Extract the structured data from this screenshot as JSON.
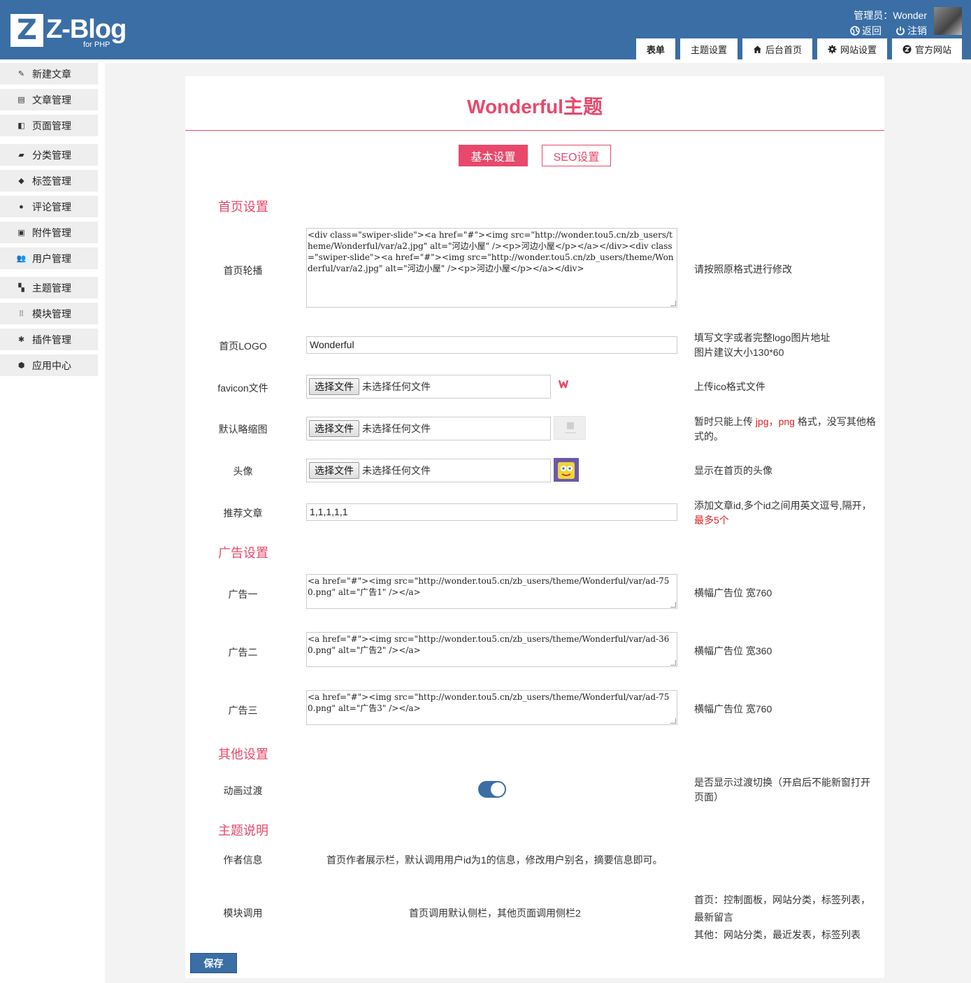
{
  "header": {
    "logo_letter": "Z",
    "logo_text": "Z-Blog",
    "logo_sub": "for PHP",
    "admin": "管理员：Wonder",
    "back": "返回",
    "logout": "注销",
    "tabs": [
      {
        "label": "表单",
        "icon": ""
      },
      {
        "label": "主题设置",
        "icon": ""
      },
      {
        "label": "后台首页",
        "icon": "home-icon"
      },
      {
        "label": "网站设置",
        "icon": "gear-icon"
      },
      {
        "label": "官方网站",
        "icon": "zblog-icon"
      }
    ]
  },
  "sidebar": {
    "items": [
      {
        "label": "新建文章",
        "icon": "edit-icon"
      },
      {
        "label": "文章管理",
        "icon": "article-icon"
      },
      {
        "label": "页面管理",
        "icon": "page-icon"
      },
      {
        "label": "分类管理",
        "icon": "folder-icon"
      },
      {
        "label": "标签管理",
        "icon": "tag-icon"
      },
      {
        "label": "评论管理",
        "icon": "comment-icon"
      },
      {
        "label": "附件管理",
        "icon": "attachment-icon"
      },
      {
        "label": "用户管理",
        "icon": "users-icon"
      },
      {
        "label": "主题管理",
        "icon": "theme-icon"
      },
      {
        "label": "模块管理",
        "icon": "module-icon"
      },
      {
        "label": "插件管理",
        "icon": "plugin-icon"
      },
      {
        "label": "应用中心",
        "icon": "app-center-icon"
      }
    ]
  },
  "page": {
    "title": "Wonderful主题",
    "tab_basic": "基本设置",
    "tab_seo": "SEO设置",
    "accent": "#e8486b",
    "brand": "#3a6ea5"
  },
  "sections": {
    "home": "首页设置",
    "ads": "广告设置",
    "other": "其他设置",
    "notes": "主题说明"
  },
  "fields": {
    "slider": {
      "label": "首页轮播",
      "value": "<div class=\"swiper-slide\"><a href=\"#\"><img src=\"http://wonder.tou5.cn/zb_users/theme/Wonderful/var/a2.jpg\" alt=\"河边小屋\" /><p>河边小屋</p></a></div><div class=\"swiper-slide\"><a href=\"#\"><img src=\"http://wonder.tou5.cn/zb_users/theme/Wonderful/var/a2.jpg\" alt=\"河边小屋\" /><p>河边小屋</p></a></div>",
      "hint": "请按照原格式进行修改"
    },
    "logo": {
      "label": "首页LOGO",
      "value": "Wonderful",
      "hint1": "填写文字或者完整logo图片地址",
      "hint2": "图片建议大小130*60"
    },
    "favicon": {
      "label": "favicon文件",
      "button": "选择文件",
      "status": "未选择任何文件",
      "hint": "上传ico格式文件"
    },
    "thumb": {
      "label": "默认略缩图",
      "button": "选择文件",
      "status": "未选择任何文件",
      "hint_a": "暂时只能上传 ",
      "hint_jpg": "jpg",
      "hint_comma": "，",
      "hint_png": "png",
      "hint_b": " 格式，没写其他格式的。"
    },
    "avatar": {
      "label": "头像",
      "button": "选择文件",
      "status": "未选择任何文件",
      "hint": "显示在首页的头像"
    },
    "recommend": {
      "label": "推荐文章",
      "value": "1,1,1,1,1",
      "hint": "添加文章id,多个id之间用英文逗号,隔开，",
      "hint_red": "最多5个"
    },
    "ad1": {
      "label": "广告一",
      "value": "<a href=\"#\"><img src=\"http://wonder.tou5.cn/zb_users/theme/Wonderful/var/ad-750.png\" alt=\"广告1\" /></a>",
      "hint": "横幅广告位 宽760"
    },
    "ad2": {
      "label": "广告二",
      "value": "<a href=\"#\"><img src=\"http://wonder.tou5.cn/zb_users/theme/Wonderful/var/ad-360.png\" alt=\"广告2\" /></a>",
      "hint": "横幅广告位 宽360"
    },
    "ad3": {
      "label": "广告三",
      "value": "<a href=\"#\"><img src=\"http://wonder.tou5.cn/zb_users/theme/Wonderful/var/ad-750.png\" alt=\"广告3\" /></a>",
      "hint": "横幅广告位 宽760"
    },
    "anim": {
      "label": "动画过渡",
      "on": true,
      "hint": "是否显示过渡切换（开启后不能新窗打开页面）"
    },
    "author": {
      "label": "作者信息",
      "desc": "首页作者展示栏，默认调用用户id为1的信息，修改用户别名，摘要信息即可。"
    },
    "module": {
      "label": "模块调用",
      "desc": "首页调用默认侧栏，其他页面调用侧栏2",
      "hint1": "首页：控制面板，网站分类，标签列表，",
      "hint2": "最新留言",
      "hint3": "其他：网站分类，最近发表，标签列表"
    }
  },
  "save": "保存"
}
